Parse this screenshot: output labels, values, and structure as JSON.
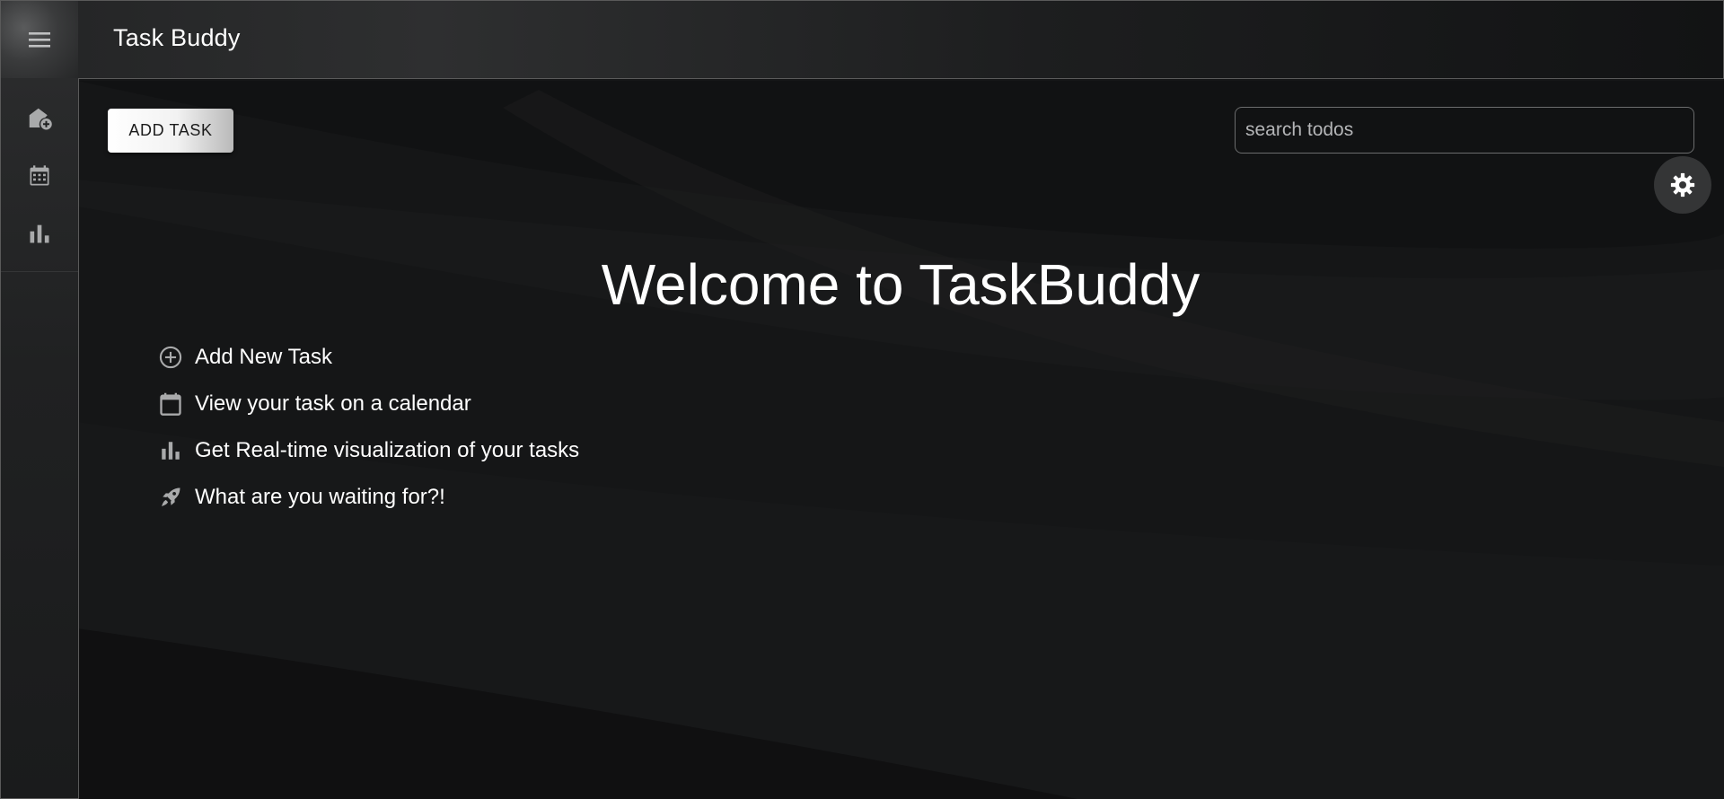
{
  "app": {
    "title": "Task Buddy"
  },
  "appbar": {
    "menu_icon": "hamburger-menu-icon"
  },
  "sidebar": {
    "items": [
      {
        "icon": "add-home-icon",
        "label": ""
      },
      {
        "icon": "calendar-icon",
        "label": ""
      },
      {
        "icon": "bar-chart-icon",
        "label": ""
      }
    ]
  },
  "toolbar": {
    "add_task_label": "ADD TASK"
  },
  "search": {
    "value": "",
    "placeholder": "search todos"
  },
  "settings": {
    "icon": "gear-icon"
  },
  "welcome": {
    "heading": "Welcome to TaskBuddy",
    "features": [
      {
        "icon": "add-circle-icon",
        "text": "Add New Task"
      },
      {
        "icon": "calendar-icon",
        "text": "View your task on a calendar"
      },
      {
        "icon": "bar-chart-icon",
        "text": "Get Real-time visualization of your tasks"
      },
      {
        "icon": "rocket-icon",
        "text": "What are you waiting for?!"
      }
    ]
  },
  "colors": {
    "background": "#151617",
    "appbar_end": "#121314",
    "icon_gray": "#a9aaab",
    "button_bg": "#ffffff",
    "button_text": "#1b1b1b",
    "settings_bg": "#343536"
  }
}
